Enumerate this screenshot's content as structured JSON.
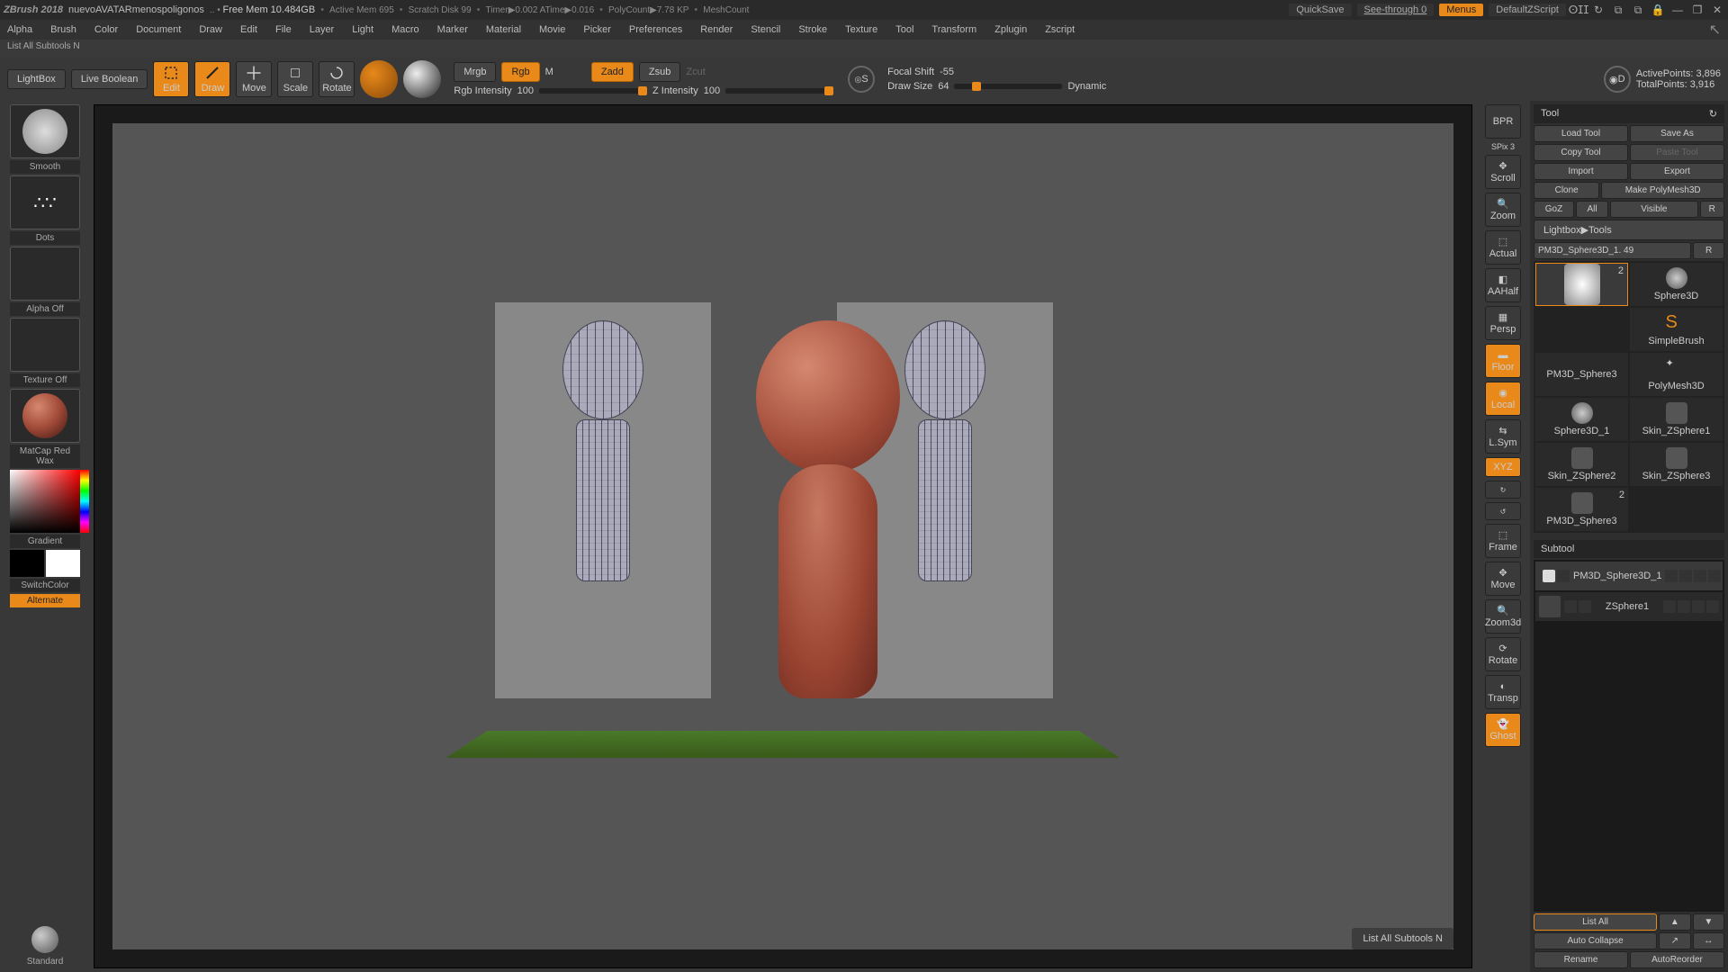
{
  "title": {
    "app": "ZBrush 2018",
    "doc": "nuevoAVATARmenospoligonos",
    "stats": [
      "Free Mem 10.484GB",
      "Active Mem 695",
      "Scratch Disk 99",
      "Timer▶0.002 ATime▶0.016",
      "PolyCount▶7.78 KP",
      "MeshCount"
    ],
    "quicksave": "QuickSave",
    "seethrough": "See-through  0",
    "menus": "Menus",
    "zscript": "DefaultZScript"
  },
  "menu": [
    "Alpha",
    "Brush",
    "Color",
    "Document",
    "Draw",
    "Edit",
    "File",
    "Layer",
    "Light",
    "Macro",
    "Marker",
    "Material",
    "Movie",
    "Picker",
    "Preferences",
    "Render",
    "Stencil",
    "Stroke",
    "Texture",
    "Tool",
    "Transform",
    "Zplugin",
    "Zscript"
  ],
  "hint": "List All Subtools  N",
  "toolbar": {
    "lightbox": "LightBox",
    "liveboolean": "Live Boolean",
    "edit": "Edit",
    "draw": "Draw",
    "move": "Move",
    "scale": "Scale",
    "rotate": "Rotate",
    "mrgb": "Mrgb",
    "rgb": "Rgb",
    "m": "M",
    "zadd": "Zadd",
    "zsub": "Zsub",
    "zcut": "Zcut",
    "rgbint": "Rgb Intensity",
    "rgbint_v": "100",
    "zint": "Z Intensity",
    "zint_v": "100",
    "focal": "Focal Shift",
    "focal_v": "-55",
    "drawsize": "Draw Size",
    "drawsize_v": "64",
    "dynamic": "Dynamic",
    "activepts": "ActivePoints:",
    "activepts_v": "3,896",
    "totalpts": "TotalPoints:",
    "totalpts_v": "3,916"
  },
  "left": {
    "brush": "Smooth",
    "stroke": "Dots",
    "alpha": "Alpha Off",
    "texture": "Texture Off",
    "material": "MatCap Red Wax",
    "gradient": "Gradient",
    "switch": "SwitchColor",
    "alternate": "Alternate",
    "standard": "Standard"
  },
  "nav": {
    "bpr": "BPR",
    "spix": "SPix  3",
    "scroll": "Scroll",
    "zoom": "Zoom",
    "actual": "Actual",
    "aahalf": "AAHalf",
    "persp": "Persp",
    "floor": "Floor",
    "local": "Local",
    "lsym": "L.Sym",
    "xyz": "XYZ",
    "frame": "Frame",
    "move": "Move",
    "zoom3d": "Zoom3d",
    "rotate": "Rotate",
    "transp": "Transp",
    "ghost": "Ghost"
  },
  "tool": {
    "hdr": "Tool",
    "load": "Load Tool",
    "save": "Save As",
    "copy": "Copy Tool",
    "paste": "Paste Tool",
    "import": "Import",
    "export": "Export",
    "clone": "Clone",
    "makepoly": "Make PolyMesh3D",
    "goz": "GoZ",
    "all": "All",
    "visible": "Visible",
    "r": "R",
    "lightbox": "Lightbox▶Tools",
    "current": "PM3D_Sphere3D_1. 49",
    "items": [
      {
        "n": "Sphere3D"
      },
      {
        "n": "PM3D_Sphere3"
      },
      {
        "n": "SimpleBrush"
      },
      {
        "n": "PolyMesh3D"
      },
      {
        "n": "Sphere3D_1"
      },
      {
        "n": "Skin_ZSphere1"
      },
      {
        "n": "Skin_ZSphere2"
      },
      {
        "n": "Skin_ZSphere3"
      },
      {
        "n": "PM3D_Sphere3"
      }
    ]
  },
  "subtool": {
    "hdr": "Subtool",
    "items": [
      {
        "n": "PM3D_Sphere3D_1",
        "sel": true
      },
      {
        "n": "ZSphere1",
        "sel": false
      }
    ],
    "listall": "List All",
    "autocollapse": "Auto Collapse",
    "rename": "Rename",
    "autoreorder": "AutoReorder"
  },
  "tooltip": "List All Subtools  N"
}
